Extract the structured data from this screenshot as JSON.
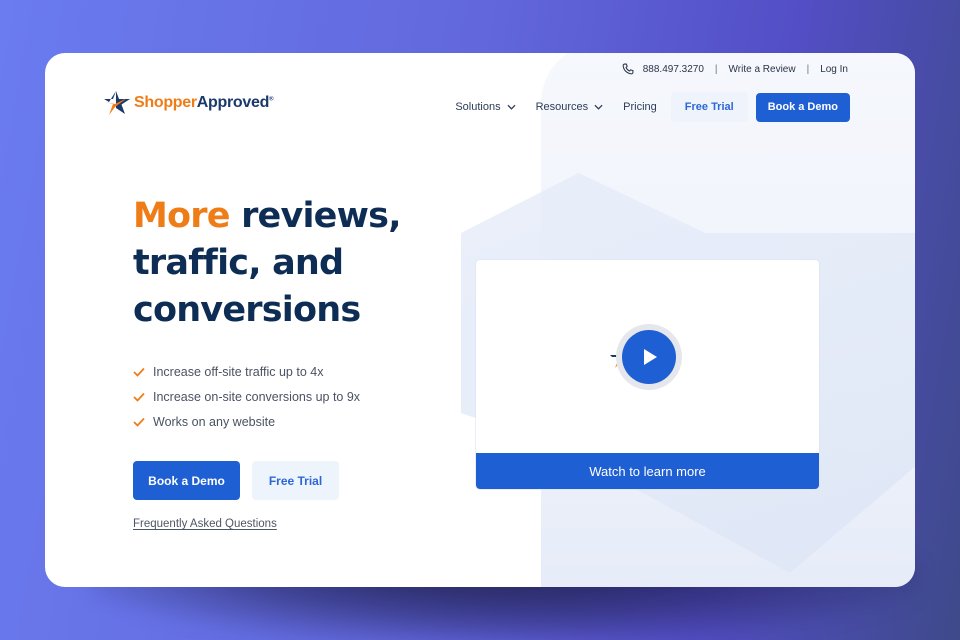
{
  "brand": {
    "name_part1": "Shopper",
    "name_part2": "Approved",
    "trademark": "®",
    "colors": {
      "orange": "#ef7d17",
      "navy": "#1b3a6b",
      "primary_blue": "#1f5fd4",
      "light_blue_bg": "#eef4fc"
    }
  },
  "topbar": {
    "phone_icon": "phone-icon",
    "phone": "888.497.3270",
    "separator": "|",
    "write_review": "Write a Review",
    "login": "Log In"
  },
  "nav": {
    "items": [
      {
        "label": "Solutions",
        "has_dropdown": true
      },
      {
        "label": "Resources",
        "has_dropdown": true
      },
      {
        "label": "Pricing",
        "has_dropdown": false
      }
    ],
    "free_trial": "Free Trial",
    "book_demo": "Book a Demo"
  },
  "hero": {
    "title_accent": "More",
    "title_rest_line1": " reviews,",
    "title_line2": "traffic, and",
    "title_line3": "conversions",
    "benefits": [
      "Increase off-site traffic up to 4x",
      "Increase on-site conversions up to 9x",
      "Works on any website"
    ],
    "book_demo": "Book a Demo",
    "free_trial": "Free Trial",
    "faq_link": "Frequently Asked Questions"
  },
  "video": {
    "play_icon": "play-icon",
    "cta": "Watch to learn more"
  }
}
